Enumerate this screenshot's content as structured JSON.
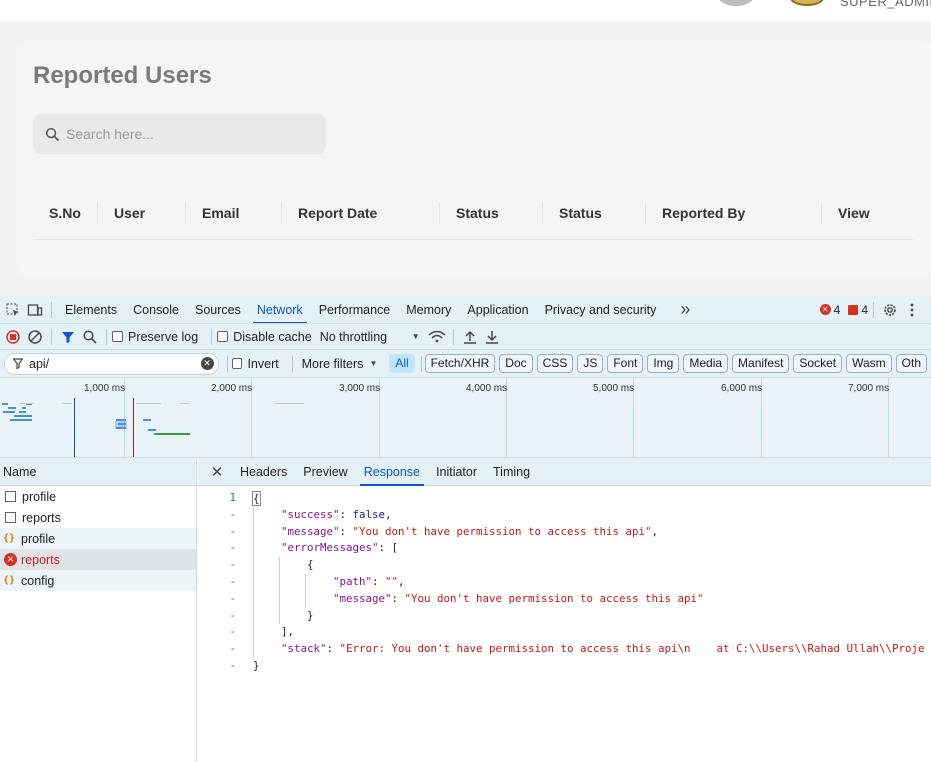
{
  "app": {
    "role_label": "SUPER_ADMIN",
    "page_title": "Reported Users",
    "search_placeholder": "Search here...",
    "columns": [
      "S.No",
      "User",
      "Email",
      "Report Date",
      "Status",
      "Status",
      "Reported By",
      "View"
    ]
  },
  "devtools": {
    "panel_tabs": [
      "Elements",
      "Console",
      "Sources",
      "Network",
      "Performance",
      "Memory",
      "Application",
      "Privacy and security"
    ],
    "active_panel": "Network",
    "more_tabs": "»",
    "error_count": "4",
    "issue_count": "4",
    "toolbar": {
      "preserve_log": "Preserve log",
      "disable_cache": "Disable cache",
      "throttling": "No throttling"
    },
    "filter": {
      "value": "api/",
      "invert": "Invert",
      "more_filters": "More filters",
      "types": [
        "All",
        "Fetch/XHR",
        "Doc",
        "CSS",
        "JS",
        "Font",
        "Img",
        "Media",
        "Manifest",
        "Socket",
        "Wasm",
        "Oth"
      ],
      "active_type": "All"
    },
    "overview_ticks": [
      "1,000 ms",
      "2,000 ms",
      "3,000 ms",
      "4,000 ms",
      "5,000 ms",
      "6,000 ms",
      "7,000 ms"
    ],
    "name_header": "Name",
    "requests": [
      {
        "name": "profile",
        "kind": "doc"
      },
      {
        "name": "reports",
        "kind": "doc"
      },
      {
        "name": "profile",
        "kind": "json"
      },
      {
        "name": "reports",
        "kind": "error"
      },
      {
        "name": "config",
        "kind": "json"
      }
    ],
    "detail_tabs": [
      "Headers",
      "Preview",
      "Response",
      "Initiator",
      "Timing"
    ],
    "active_detail_tab": "Response",
    "response_lines": [
      {
        "n": "1",
        "text": "{"
      },
      {
        "n": "-",
        "key": "\"success\"",
        "value": "false",
        "vtype": "b",
        "tail": ","
      },
      {
        "n": "-",
        "key": "\"message\"",
        "value": "\"You don't have permission to access this api\"",
        "vtype": "s",
        "tail": ","
      },
      {
        "n": "-",
        "key": "\"errorMessages\"",
        "value": "[",
        "vtype": "p",
        "tail": ""
      },
      {
        "n": "-",
        "text": "{"
      },
      {
        "n": "-",
        "key": "\"path\"",
        "value": "\"\"",
        "vtype": "s",
        "tail": ","
      },
      {
        "n": "-",
        "key": "\"message\"",
        "value": "\"You don't have permission to access this api\"",
        "vtype": "s",
        "tail": ""
      },
      {
        "n": "-",
        "text": "}"
      },
      {
        "n": "-",
        "text": "],"
      },
      {
        "n": "-",
        "key": "\"stack\"",
        "value": "\"Error: You don't have permission to access this api\\n    at C:\\\\Users\\\\Rahad Ullah\\\\Proje",
        "vtype": "s",
        "tail": ""
      },
      {
        "n": "-",
        "text": "}"
      }
    ]
  }
}
